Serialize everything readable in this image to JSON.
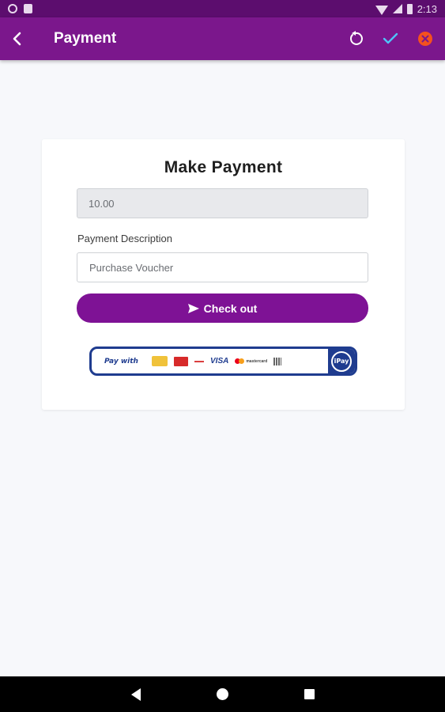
{
  "status_bar": {
    "time": "2:13",
    "left_icons": [
      "settings-gear-icon",
      "sim-card-icon"
    ],
    "right_icons": [
      "wifi-icon",
      "signal-icon",
      "battery-icon"
    ]
  },
  "app_bar": {
    "title": "Payment",
    "background": "#7b178c",
    "icons": [
      "back-arrow-icon",
      "refresh-icon",
      "check-icon",
      "close-circle-icon"
    ],
    "check_color": "#4fc3f7",
    "close_color": "#f4511e"
  },
  "card": {
    "title": "Make Payment",
    "amount_value": "10.00",
    "description_label": "Payment Description",
    "description_placeholder": "Purchase Voucher",
    "checkout_label": "Check out",
    "checkout_icon": "send-icon",
    "button_color": "#7e1295"
  },
  "pay_banner": {
    "pay_with_text": "Pay with",
    "visa_text": "VISA",
    "mastercard_text": "mastercard",
    "ipay_text": "iPay",
    "border_color": "#1f3c8f"
  },
  "nav_bar": {
    "icons": [
      "nav-back-icon",
      "nav-home-icon",
      "nav-recents-icon"
    ]
  }
}
